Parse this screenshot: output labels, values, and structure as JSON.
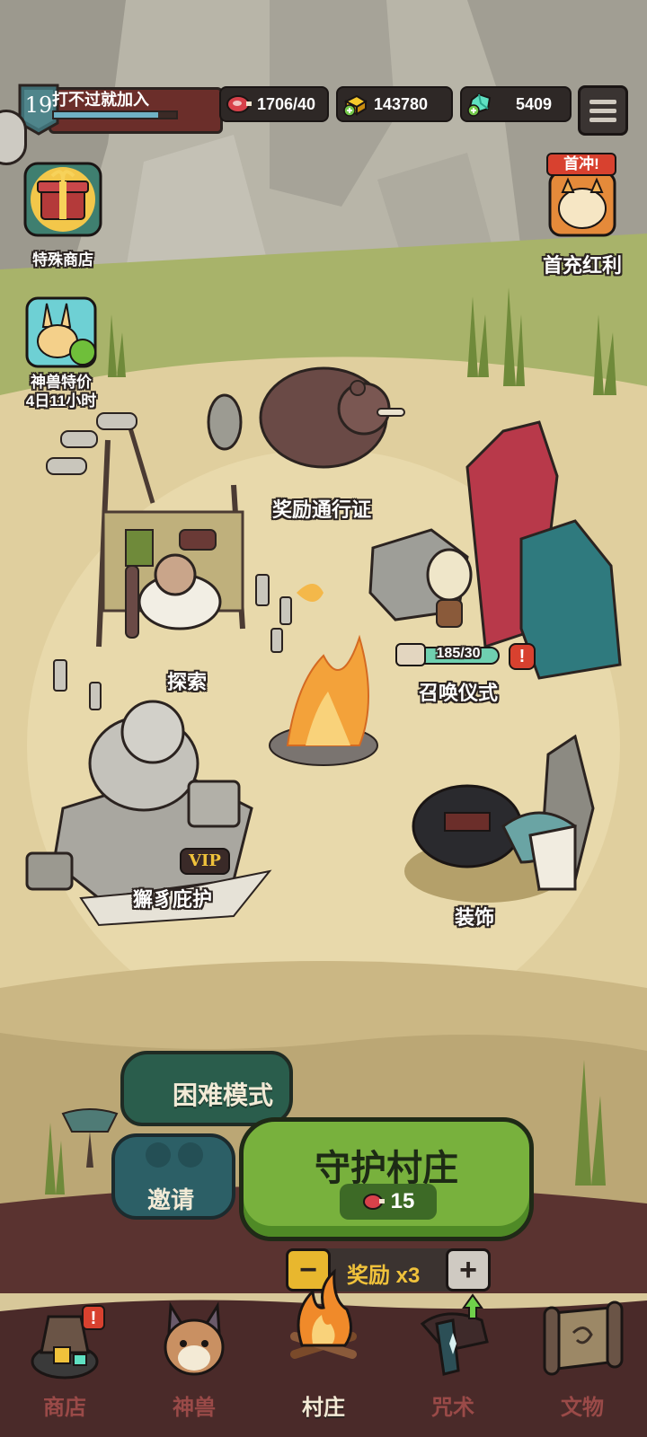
{
  "player": {
    "level": "19",
    "name": "打不过就加入",
    "xp_progress": 0.85
  },
  "resources": {
    "meat": "1706/40",
    "gold": "143780",
    "gems": "5409"
  },
  "side_left": [
    {
      "label": "特殊商店"
    },
    {
      "label": "神兽特价",
      "timer": "4日11小时"
    }
  ],
  "side_right": [
    {
      "label": "首充红利",
      "badge": "首冲!"
    }
  ],
  "buildings": {
    "bear": "奖励通行证",
    "explore": "探索",
    "ritual": "召唤仪式",
    "ritual_count": "185/30",
    "guardian": "獬豸庇护",
    "vip": "VIP",
    "decor": "装饰"
  },
  "actions": {
    "hard_mode": "困难模式",
    "invite": "邀请",
    "guard_village": "守护村庄",
    "cost": "15",
    "reward": "奖励 x3"
  },
  "nav": [
    {
      "label": "商店",
      "icon": "shop-icon"
    },
    {
      "label": "神兽",
      "icon": "beast-icon"
    },
    {
      "label": "村庄",
      "icon": "campfire-icon",
      "active": true
    },
    {
      "label": "咒术",
      "icon": "spell-icon"
    },
    {
      "label": "文物",
      "icon": "scroll-icon"
    }
  ],
  "colors": {
    "accent_green": "#78b13d",
    "nav_inactive": "#9a4a48",
    "alert": "#d8412f"
  }
}
